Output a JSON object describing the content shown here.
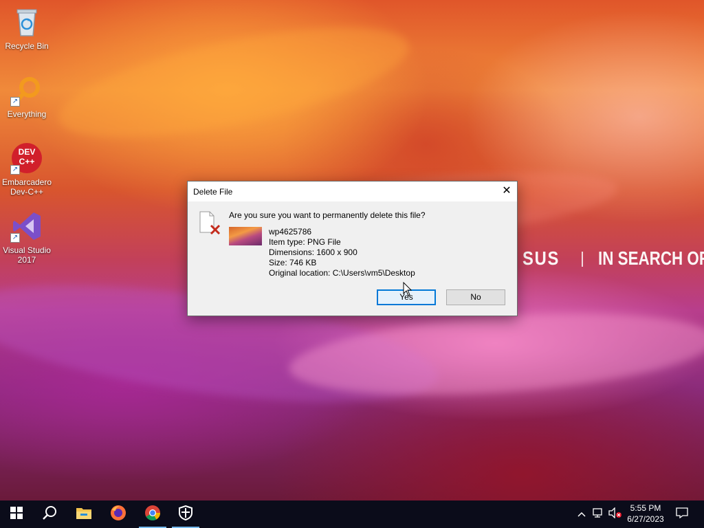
{
  "desktop": {
    "icons": [
      {
        "label": "Recycle Bin",
        "icon": "recycle-bin-icon"
      },
      {
        "label": "Everything",
        "icon": "everything-search-icon"
      },
      {
        "label": "Embarcadero Dev-C++",
        "icon": "devcpp-icon",
        "badge_text": "DEV C++"
      },
      {
        "label": "Visual Studio 2017",
        "icon": "visual-studio-icon"
      }
    ],
    "wallpaper_brand": "SUS",
    "wallpaper_slogan": "IN SEARCH OF"
  },
  "dialog": {
    "title": "Delete File",
    "close_label": "✕",
    "question": "Are you sure you want to permanently delete this file?",
    "file_name": "wp4625786",
    "item_type": "Item type: PNG File",
    "dimensions": "Dimensions: 1600 x 900",
    "size": "Size: 746 KB",
    "location": "Original location: C:\\Users\\vm5\\Desktop",
    "yes_label": "Yes",
    "no_label": "No"
  },
  "taskbar": {
    "items": [
      "start-icon",
      "search-icon",
      "file-explorer-icon",
      "firefox-icon",
      "chrome-icon",
      "security-shield-icon"
    ],
    "tray_icons": [
      "chevron-up-icon",
      "network-icon",
      "volume-muted-icon"
    ],
    "time": "5:55 PM",
    "date": "6/27/2023",
    "notification_icon": "action-center-icon"
  },
  "colors": {
    "accent": "#0078d7",
    "taskbar_bg": "#0b0c1a",
    "dialog_bg": "#f0f0f0",
    "error_red": "#c42b1c"
  }
}
